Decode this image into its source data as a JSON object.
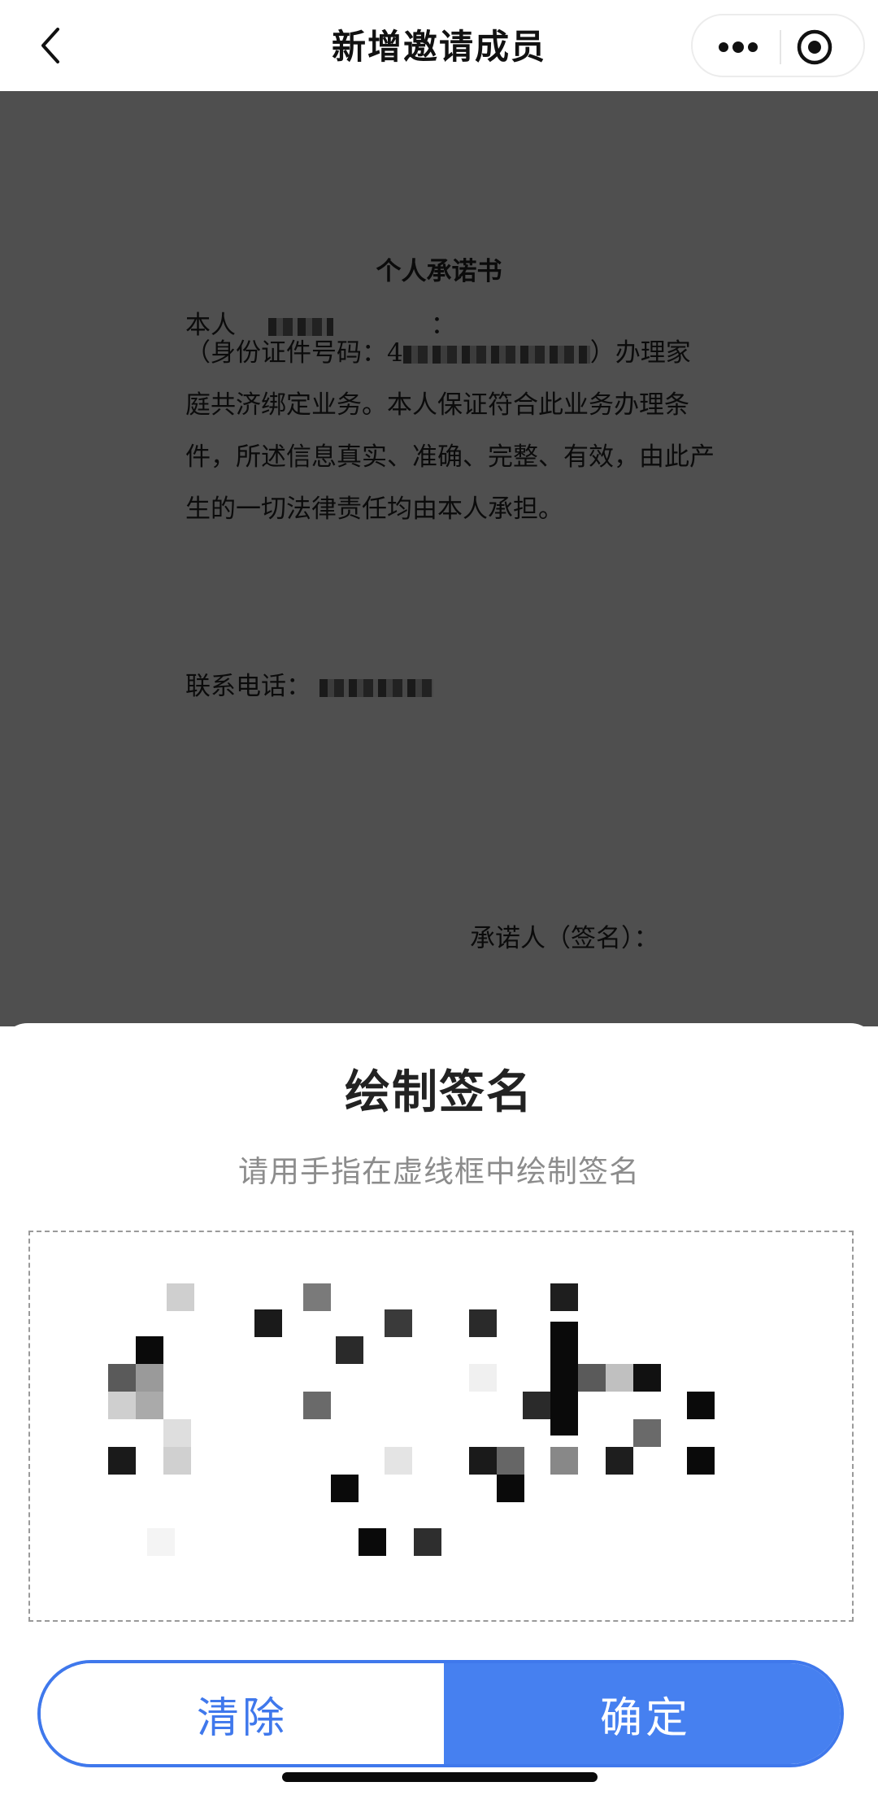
{
  "navbar": {
    "title": "新增邀请成员",
    "back_icon": "chevron-left-icon",
    "more_icon": "more-dots-icon",
    "close_icon": "record-target-icon"
  },
  "document": {
    "title": "个人承诺书",
    "line1_prefix": "本人",
    "line1_suffix": "：",
    "para_start": "（身份证件号码：4",
    "para_rest": "）办理家庭共济绑定业务。本人保证符合此业务办理条件，所述信息真实、准确、完整、有效，由此产生的一切法律责任均由本人承担。",
    "phone_label": "联系电话：",
    "signer_label": "承诺人（签名）："
  },
  "sheet": {
    "title": "绘制签名",
    "subtitle": "请用手指在虚线框中绘制签名",
    "clear_label": "清除",
    "confirm_label": "确定"
  },
  "colors": {
    "accent": "#4680f0",
    "overlay": "#4f4f4f",
    "subtitle": "#8c8c8c"
  }
}
